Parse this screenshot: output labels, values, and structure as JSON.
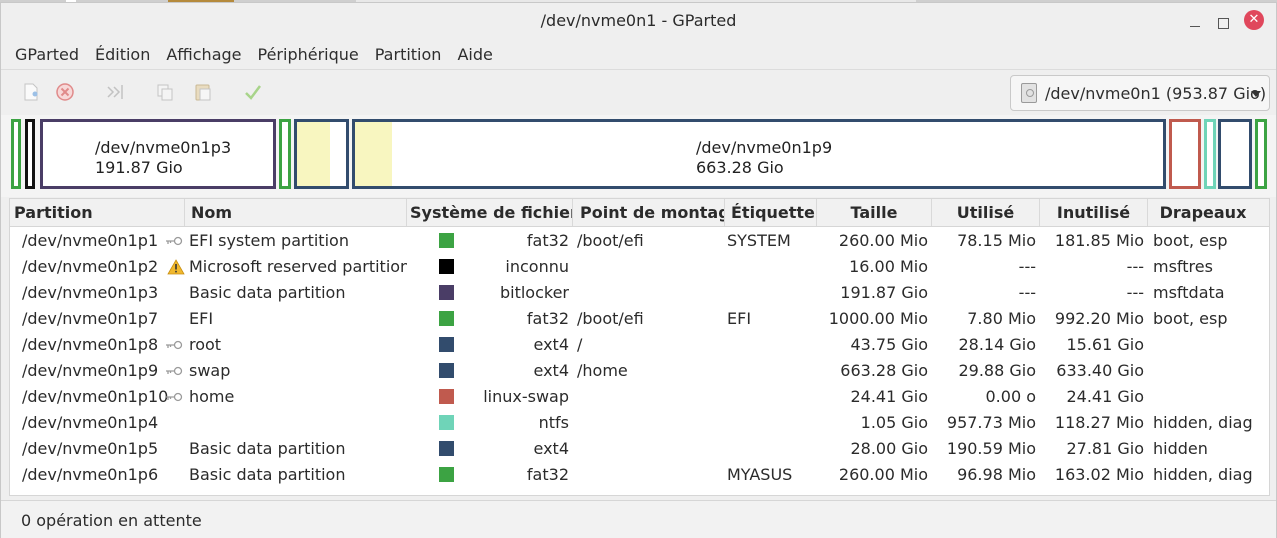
{
  "window": {
    "title": "/dev/nvme0n1 - GParted",
    "close_glyph": "✕"
  },
  "menu": [
    "GParted",
    "Édition",
    "Affichage",
    "Périphérique",
    "Partition",
    "Aide"
  ],
  "toolbar": {
    "icons": [
      "new-icon",
      "delete-icon",
      "resize-move-icon",
      "copy-icon",
      "paste-icon",
      "apply-icon"
    ],
    "device": "/dev/nvme0n1 (953.87 Gio)"
  },
  "map": {
    "p3": {
      "name": "/dev/nvme0n1p3",
      "size": "191.87 Gio"
    },
    "p9": {
      "name": "/dev/nvme0n1p9",
      "size": "663.28 Gio"
    }
  },
  "table": {
    "headers": [
      "Partition",
      "Nom",
      "Système de fichiers",
      "Point de montage",
      "Étiquette",
      "Taille",
      "Utilisé",
      "Inutilisé",
      "Drapeaux"
    ],
    "rows": [
      {
        "partition": "/dev/nvme0n1p1",
        "icon": "key-icon",
        "name": "EFI system partition",
        "color": "#3ca343",
        "fs": "fat32",
        "mount": "/boot/efi",
        "label": "SYSTEM",
        "size": "260.00 Mio",
        "used": "78.15 Mio",
        "unused": "181.85 Mio",
        "flags": "boot, esp"
      },
      {
        "partition": "/dev/nvme0n1p2",
        "icon": "warning-icon",
        "name": "Microsoft reserved partition",
        "color": "#000000",
        "fs": "inconnu",
        "mount": "",
        "label": "",
        "size": "16.00 Mio",
        "used": "---",
        "unused": "---",
        "flags": "msftres"
      },
      {
        "partition": "/dev/nvme0n1p3",
        "icon": "",
        "name": "Basic data partition",
        "color": "#4a3d66",
        "fs": "bitlocker",
        "mount": "",
        "label": "",
        "size": "191.87 Gio",
        "used": "---",
        "unused": "---",
        "flags": "msftdata"
      },
      {
        "partition": "/dev/nvme0n1p7",
        "icon": "",
        "name": "EFI",
        "color": "#3ca343",
        "fs": "fat32",
        "mount": "/boot/efi",
        "label": "EFI",
        "size": "1000.00 Mio",
        "used": "7.80 Mio",
        "unused": "992.20 Mio",
        "flags": "boot, esp"
      },
      {
        "partition": "/dev/nvme0n1p8",
        "icon": "key-icon",
        "name": "root",
        "color": "#324c6d",
        "fs": "ext4",
        "mount": "/",
        "label": "",
        "size": "43.75 Gio",
        "used": "28.14 Gio",
        "unused": "15.61 Gio",
        "flags": ""
      },
      {
        "partition": "/dev/nvme0n1p9",
        "icon": "key-icon",
        "name": "swap",
        "color": "#324c6d",
        "fs": "ext4",
        "mount": "/home",
        "label": "",
        "size": "663.28 Gio",
        "used": "29.88 Gio",
        "unused": "633.40 Gio",
        "flags": ""
      },
      {
        "partition": "/dev/nvme0n1p10",
        "icon": "key-icon",
        "name": "home",
        "color": "#c05a4e",
        "fs": "linux-swap",
        "mount": "",
        "label": "",
        "size": "24.41 Gio",
        "used": "0.00 o",
        "unused": "24.41 Gio",
        "flags": ""
      },
      {
        "partition": "/dev/nvme0n1p4",
        "icon": "",
        "name": "",
        "color": "#6fd4b8",
        "fs": "ntfs",
        "mount": "",
        "label": "",
        "size": "1.05 Gio",
        "used": "957.73 Mio",
        "unused": "118.27 Mio",
        "flags": "hidden, diag"
      },
      {
        "partition": "/dev/nvme0n1p5",
        "icon": "",
        "name": "Basic data partition",
        "color": "#324c6d",
        "fs": "ext4",
        "mount": "",
        "label": "",
        "size": "28.00 Gio",
        "used": "190.59 Mio",
        "unused": "27.81 Gio",
        "flags": "hidden"
      },
      {
        "partition": "/dev/nvme0n1p6",
        "icon": "",
        "name": "Basic data partition",
        "color": "#3ca343",
        "fs": "fat32",
        "mount": "",
        "label": "MYASUS",
        "size": "260.00 Mio",
        "used": "96.98 Mio",
        "unused": "163.02 Mio",
        "flags": "hidden, diag"
      }
    ]
  },
  "status": "0 opération en attente"
}
